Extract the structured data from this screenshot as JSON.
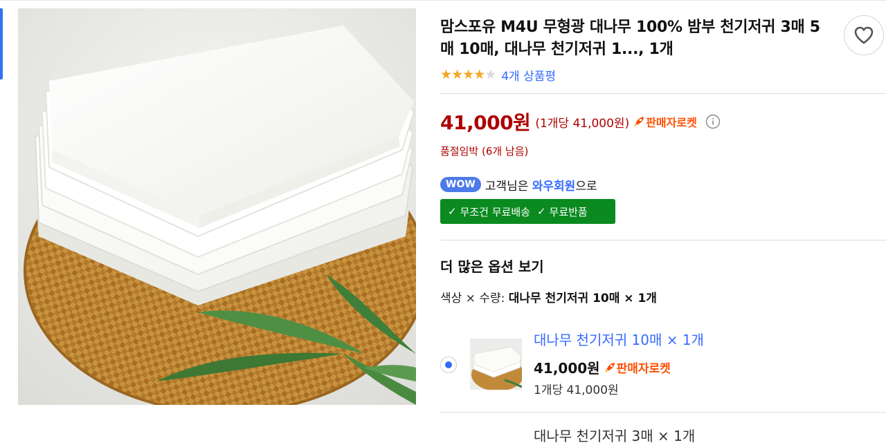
{
  "product": {
    "title": "맘스포유 M4U 무형광 대나무 100% 밤부 천기저귀 3매 5매 10매, 대나무 천기저귀 1..., 1개",
    "rating": 4,
    "rating_max": 5,
    "review_link": "4개 상품평",
    "wishlist_icon": "heart-icon"
  },
  "price": {
    "amount": "41,000원",
    "unit_price": "(1개당 41,000원)",
    "seller_rocket": "판매자로켓",
    "info_icon": "info-icon",
    "stock_status": "품절임박 (6개 남음)"
  },
  "membership": {
    "badge": "WOW",
    "text_prefix": "고객님은 ",
    "member_name": "와우회원",
    "text_suffix": "으로",
    "benefit_1": "무조건 무료배송",
    "benefit_2": "무료반품"
  },
  "options": {
    "heading": "더 많은 옵션 보기",
    "summary_label": "색상 × 수량: ",
    "summary_value": "대나무 천기저귀 10매 × 1개",
    "items": [
      {
        "name": "대나무 천기저귀 10매 × 1개",
        "price": "41,000원",
        "badge": "판매자로켓",
        "unit_price": "1개당 41,000원",
        "selected": true
      },
      {
        "name": "대나무 천기저귀 3매 × 1개"
      }
    ]
  },
  "colors": {
    "price_red": "#ae0000",
    "link_blue": "#346aff",
    "rocket_orange": "#ff4f00",
    "benefit_green": "#0a8a1f",
    "star_gold": "#f5a623"
  }
}
